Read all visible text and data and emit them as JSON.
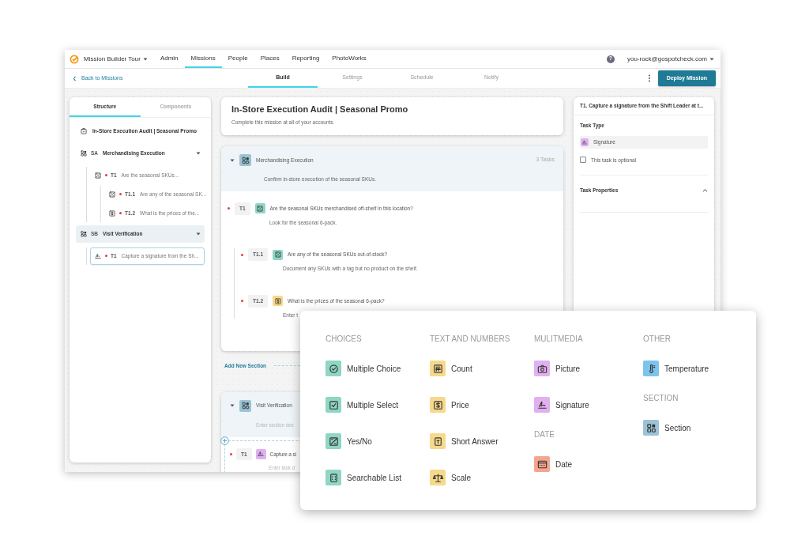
{
  "top_nav": {
    "workspace": "Mission Builder Tour",
    "links": [
      {
        "label": "Admin",
        "selected": false
      },
      {
        "label": "Missions",
        "selected": true
      },
      {
        "label": "People",
        "selected": false
      },
      {
        "label": "Places",
        "selected": false
      },
      {
        "label": "Reporting",
        "selected": false
      },
      {
        "label": "PhotoWorks",
        "selected": false
      }
    ],
    "help": "?",
    "user": "you-rock@gospotcheck.com"
  },
  "sub_nav": {
    "back": "Back to Missions",
    "tabs": [
      {
        "label": "Build",
        "selected": true
      },
      {
        "label": "Settings",
        "selected": false
      },
      {
        "label": "Schedule",
        "selected": false
      },
      {
        "label": "Notify",
        "selected": false
      }
    ],
    "deploy_button": "Deploy Mission"
  },
  "structure_panel": {
    "tabs": [
      {
        "label": "Structure",
        "selected": true
      },
      {
        "label": "Components",
        "selected": false
      }
    ],
    "tree": [
      {
        "kind": "mission",
        "label": "In-Store Execution Audit | Seasonal Promo",
        "selected": false
      },
      {
        "kind": "section",
        "code": "SA",
        "label": "Merchandising Execution",
        "expanded": true,
        "active": false,
        "selected": false,
        "children": [
          {
            "kind": "yes_no",
            "code": "T1",
            "label": "Are the seasonal SKUs...",
            "required": true,
            "selected": false,
            "children": [
              {
                "kind": "yes_no",
                "code": "T1.1",
                "label": "Are any of the seasonal SK...",
                "required": true,
                "selected": false
              },
              {
                "kind": "price",
                "code": "T1.2",
                "label": "What is the prices of the...",
                "required": true,
                "selected": false
              }
            ]
          }
        ]
      },
      {
        "kind": "section",
        "code": "SB",
        "label": "Visit Verification",
        "expanded": true,
        "active": true,
        "selected": false,
        "children": [
          {
            "kind": "signature",
            "code": "T1",
            "label": "Capture a signature from the Sh...",
            "required": true,
            "selected": true
          }
        ]
      }
    ]
  },
  "mission": {
    "title": "In-Store Execution Audit | Seasonal Promo",
    "subtitle": "Complete this mission at all of your accounts."
  },
  "sections": [
    {
      "kind": "section",
      "color": "#9cc3d5",
      "title": "Merchandising Execution",
      "task_count": "3 Tasks",
      "expanded": true,
      "description": "Confirm in-store execution of the seasonal SKUs.",
      "tasks": [
        {
          "code": "T1",
          "kind": "yes_no",
          "color": "#8fd6c4",
          "question": "Are the seasonal SKUs merchandised off-shelf in this location?",
          "required": true,
          "description": "Look for the seasonal 6-pack.",
          "children": [
            {
              "code": "T1.1",
              "kind": "yes_no",
              "color": "#8fd6c4",
              "question": "Are any of the seasonal SKUs out-of-stock?",
              "required": true,
              "description": "Document any SKUs with a tag but no product on the shelf."
            },
            {
              "code": "T1.2",
              "kind": "price",
              "color": "#f7d98b",
              "question": "What is the prices of the seasonal 6-pack?",
              "required": true,
              "description": "Enter t"
            }
          ]
        }
      ]
    },
    {
      "kind": "section",
      "color": "#9cc3d5",
      "title": "Visit Verification",
      "expanded": true,
      "description_placeholder": "Enter section des",
      "add_buttons": true,
      "tasks": [
        {
          "code": "T1",
          "kind": "signature",
          "color": "#e0b0f0",
          "question": "Capture a si",
          "required": true,
          "description_placeholder": "Enter task d"
        }
      ]
    }
  ],
  "add_section": "Add New Section",
  "task_panel": {
    "title": "T1. Capture a signature from the Shift Leader at t...",
    "type_label": "Task Type",
    "type": {
      "kind": "signature",
      "color": "#e0b0f0",
      "label": "Signature"
    },
    "optional": {
      "label": "This task is optional",
      "checked": false
    },
    "properties": {
      "label": "Task Properties",
      "expanded": true
    }
  },
  "palette": {
    "columns": [
      {
        "groups": [
          {
            "heading": "CHOICES",
            "items": [
              {
                "kind": "multiple_choice",
                "label": "Multiple Choice",
                "color": "#8fd6c4"
              },
              {
                "kind": "multiple_select",
                "label": "Multiple Select",
                "color": "#8fd6c4"
              },
              {
                "kind": "yes_no",
                "label": "Yes/No",
                "color": "#8fd6c4"
              },
              {
                "kind": "searchable_list",
                "label": "Searchable List",
                "color": "#8fd6c4"
              }
            ]
          }
        ]
      },
      {
        "groups": [
          {
            "heading": "TEXT AND NUMBERS",
            "items": [
              {
                "kind": "count",
                "label": "Count",
                "color": "#f7d98b"
              },
              {
                "kind": "price",
                "label": "Price",
                "color": "#f7d98b"
              },
              {
                "kind": "short_answer",
                "label": "Short Answer",
                "color": "#f7d98b"
              },
              {
                "kind": "scale",
                "label": "Scale",
                "color": "#f7d98b"
              }
            ]
          }
        ]
      },
      {
        "groups": [
          {
            "heading": "MULITMEDIA",
            "items": [
              {
                "kind": "picture",
                "label": "Picture",
                "color": "#e0b0f0"
              },
              {
                "kind": "signature",
                "label": "Signature",
                "color": "#e0b0f0"
              }
            ]
          },
          {
            "heading": "DATE",
            "items": [
              {
                "kind": "date",
                "label": "Date",
                "color": "#f4a58e"
              }
            ]
          }
        ]
      },
      {
        "groups": [
          {
            "heading": "OTHER",
            "items": [
              {
                "kind": "temperature",
                "label": "Temperature",
                "color": "#7cc4ec"
              }
            ]
          },
          {
            "heading": "SECTION",
            "items": [
              {
                "kind": "section",
                "label": "Section",
                "color": "#9cc3d5"
              }
            ]
          }
        ]
      }
    ]
  }
}
